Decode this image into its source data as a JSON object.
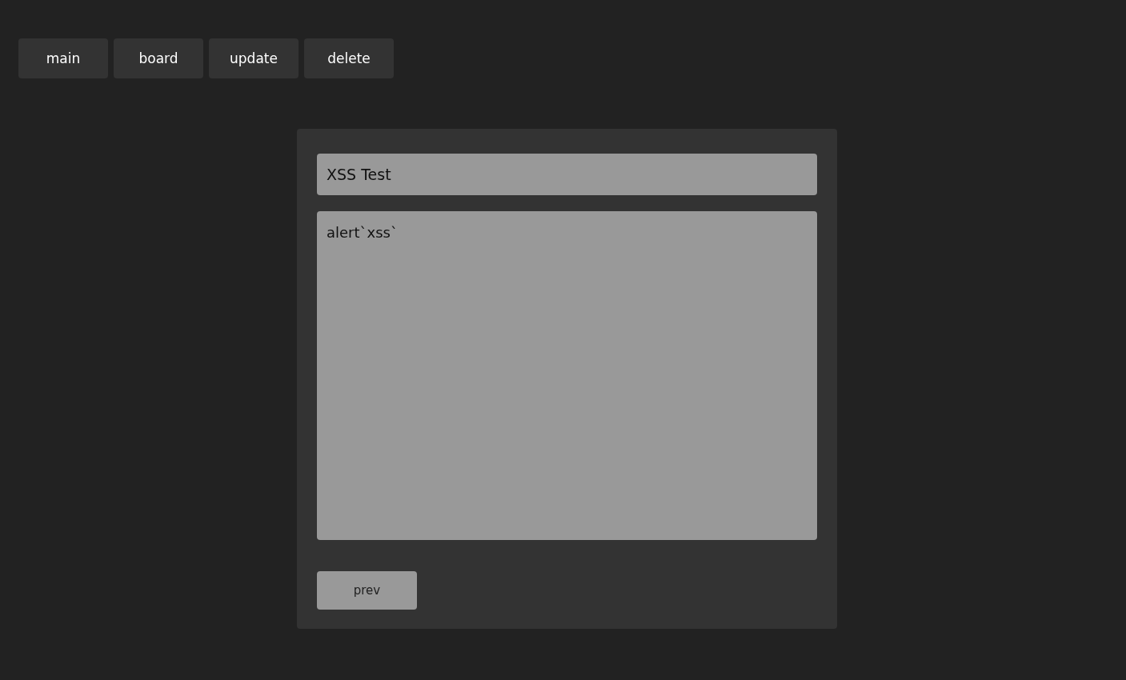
{
  "nav": [
    {
      "label": "main"
    },
    {
      "label": "board"
    },
    {
      "label": "update"
    },
    {
      "label": "delete"
    }
  ],
  "post": {
    "title": "XSS Test",
    "content": "alert`xss`"
  },
  "buttons": [
    {
      "label": "prev"
    }
  ]
}
